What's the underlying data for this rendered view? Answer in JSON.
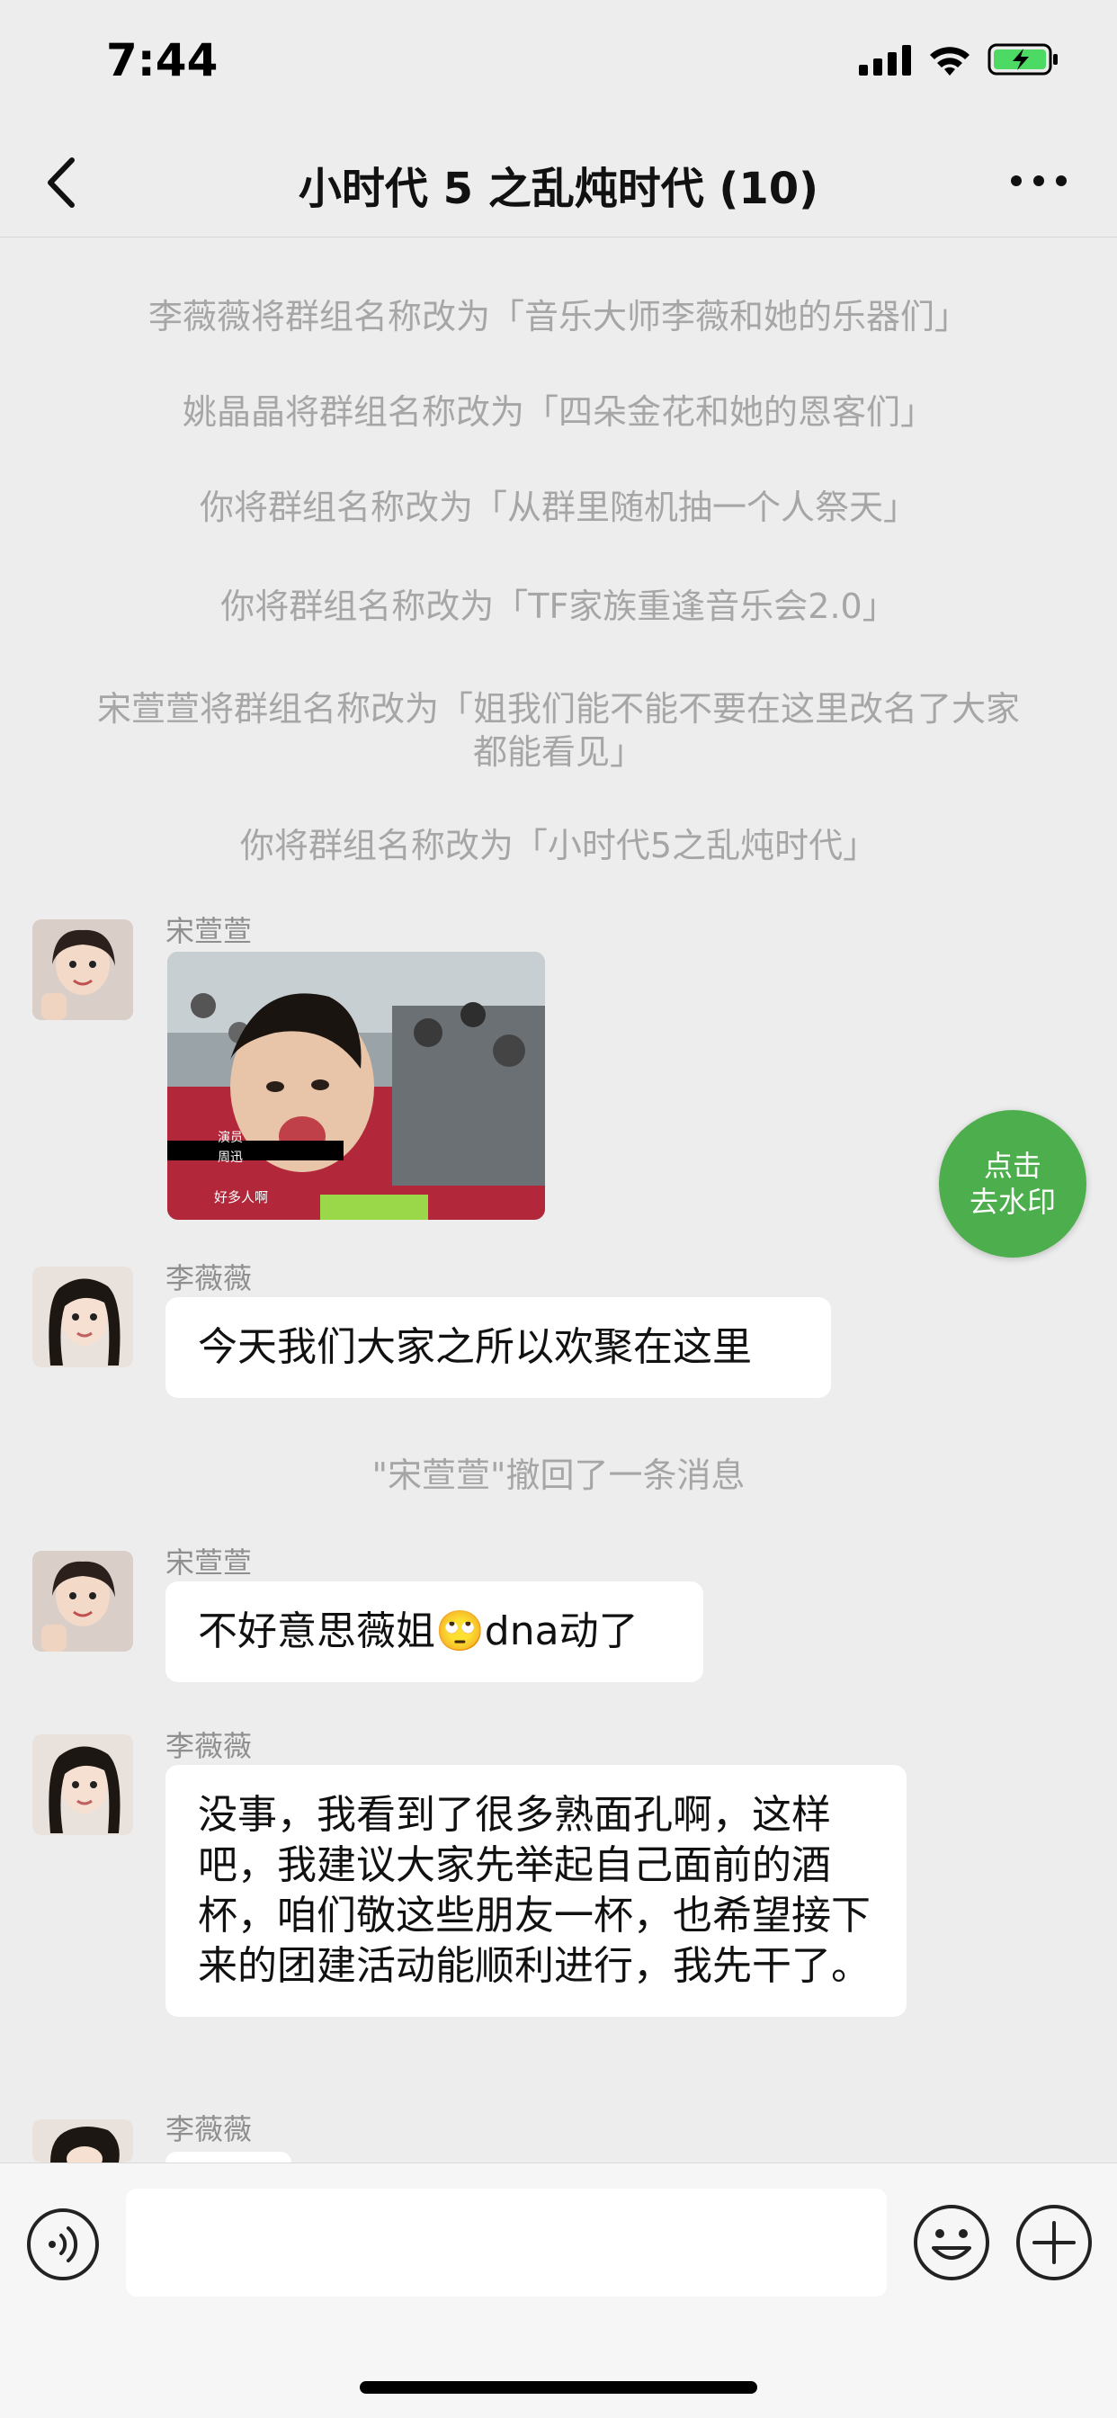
{
  "status_bar": {
    "time": "7:44"
  },
  "nav": {
    "title": "小时代 5 之乱炖时代 (10)"
  },
  "system_messages": [
    "李薇薇将群组名称改为「音乐大师李薇和她的乐器们」",
    "姚晶晶将群组名称改为「四朵金花和她的恩客们」",
    "你将群组名称改为「从群里随机抽一个人祭天」",
    "你将群组名称改为「TF家族重逢音乐会2.0」",
    "宋萱萱将群组名称改为「姐我们能不能不要在这里改名了大家都能看见」",
    "你将群组名称改为「小时代5之乱炖时代」"
  ],
  "messages": [
    {
      "sender": "宋萱萱",
      "type": "image",
      "image_caption_lines": [
        "演员",
        "周迅",
        "好多人啊"
      ]
    },
    {
      "sender": "李薇薇",
      "type": "text",
      "text": "今天我们大家之所以欢聚在这里"
    },
    {
      "type": "recall",
      "text": "\"宋萱萱\"撤回了一条消息"
    },
    {
      "sender": "宋萱萱",
      "type": "text",
      "text": "不好意思薇姐🙄dna动了"
    },
    {
      "sender": "李薇薇",
      "type": "text",
      "text": "没事，我看到了很多熟面孔啊，这样吧，我建议大家先举起自己面前的酒杯，咱们敬这些朋友一杯，也希望接下来的团建活动能顺利进行，我先干了。"
    },
    {
      "sender": "李薇薇",
      "type": "partial"
    }
  ],
  "watermark_button": {
    "line1": "点击",
    "line2": "去水印"
  },
  "colors": {
    "accent_green": "#4cae4c",
    "background": "#ededed",
    "system_text": "#a6a6a6"
  }
}
